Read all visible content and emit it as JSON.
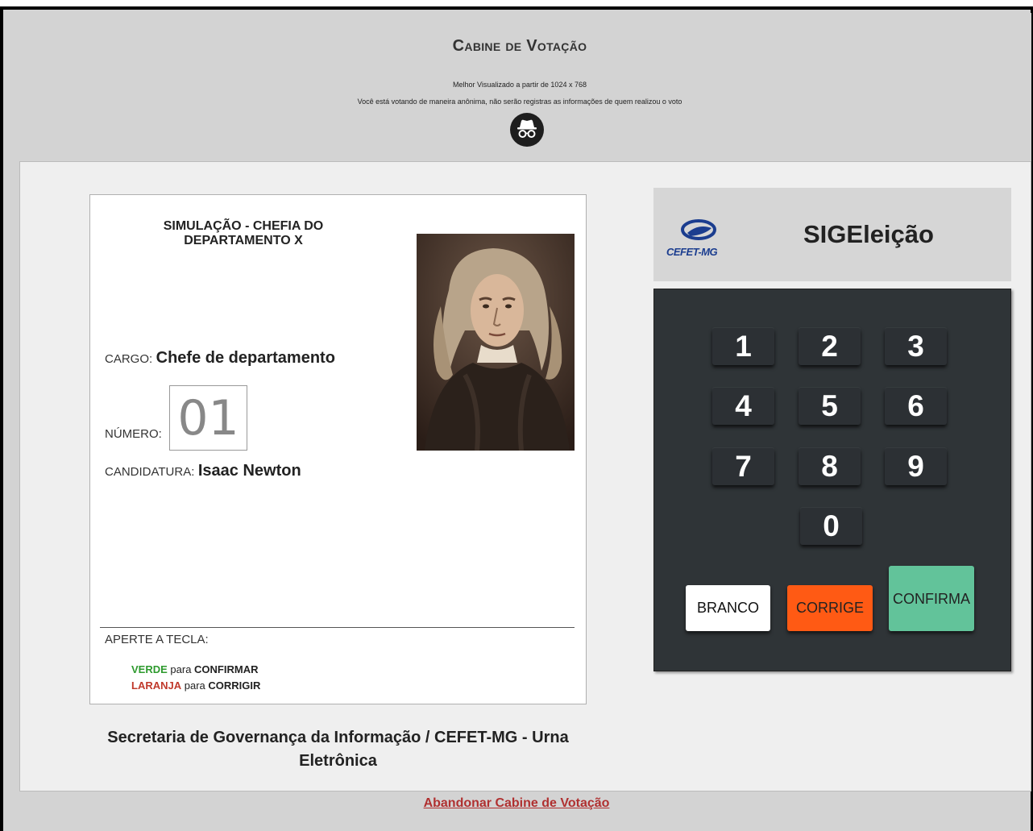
{
  "header": {
    "title": "Cabine de Votação",
    "subtitle_resolution": "Melhor Visualizado a partir de 1024 x 768",
    "subtitle_anonymous": "Você está votando de maneira anônima, não serão registras as informações de quem realizou o voto",
    "anonymous_icon": "incognito-icon"
  },
  "ballot": {
    "title": "SIMULAÇÃO - CHEFIA DO DEPARTAMENTO X",
    "candidate_photo": "candidate-photo",
    "cargo_label": "CARGO:",
    "cargo_value": "Chefe de departamento",
    "numero_label": "NÚMERO:",
    "numero_value": "01",
    "candidatura_label": "CANDIDATURA:",
    "candidatura_value": "Isaac Newton",
    "aperte_label": "APERTE A TECLA:",
    "instr_green_word": "VERDE",
    "instr_green_mid": " para ",
    "instr_green_action": "CONFIRMAR",
    "instr_orange_word": "LARANJA",
    "instr_orange_mid": " para ",
    "instr_orange_action": "CORRIGIR"
  },
  "footer_text": "Secretaria de Governança da Informação / CEFET-MG - Urna Eletrônica",
  "brand": {
    "logo_text": "CEFET-MG",
    "system_name": "SIGEleição"
  },
  "keypad": {
    "keys": [
      "1",
      "2",
      "3",
      "4",
      "5",
      "6",
      "7",
      "8",
      "9",
      "0"
    ],
    "branco": "BRANCO",
    "corrige": "CORRIGE",
    "confirma": "CONFIRMA"
  },
  "colors": {
    "branco": "#ffffff",
    "corrige": "#ff5a14",
    "confirma": "#62c39a",
    "keypad_bg": "#2f3437"
  },
  "bottom_link": "Abandonar Cabine de Votação"
}
